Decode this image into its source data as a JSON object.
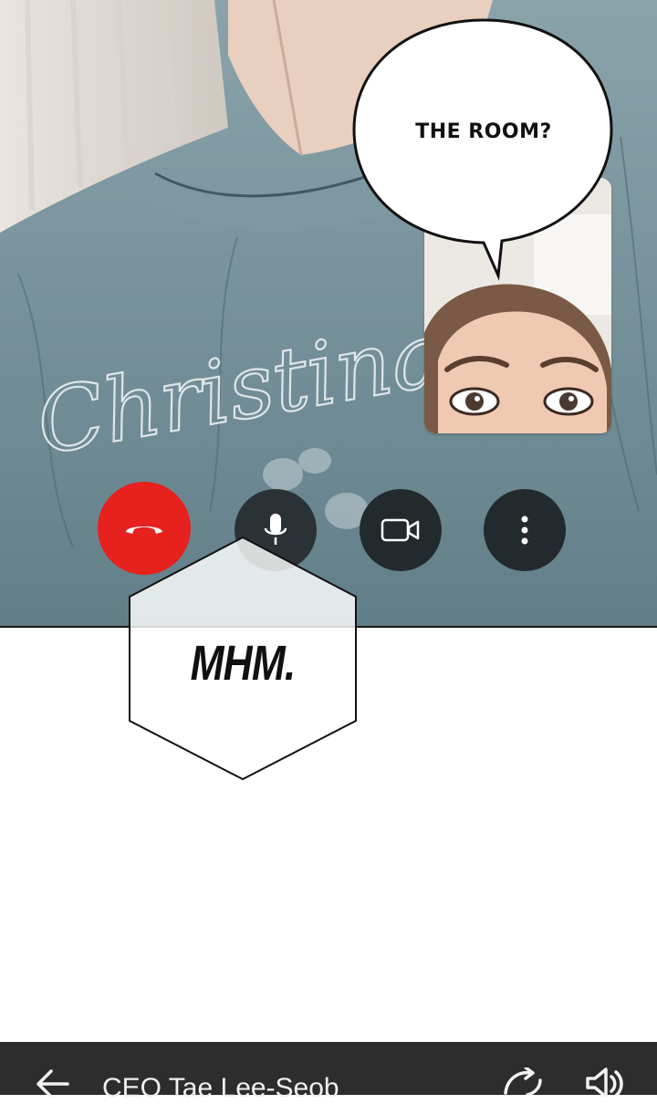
{
  "speech_bubble": {
    "text": "THE ROOM?"
  },
  "shirt_print": {
    "text": "Christina"
  },
  "call_controls": {
    "end_call": {
      "icon": "phone-hangup-icon",
      "color": "#e6211e"
    },
    "mute": {
      "icon": "microphone-icon"
    },
    "video": {
      "icon": "video-camera-icon"
    },
    "more": {
      "icon": "more-vertical-icon"
    }
  },
  "caption": {
    "text": "MHM."
  },
  "app_bar": {
    "back_icon": "arrow-left-icon",
    "title": "CEO Tae Lee-Seob",
    "rotate_icon": "rotate-icon",
    "speaker_icon": "speaker-icon",
    "background": "#2d2d2d"
  }
}
